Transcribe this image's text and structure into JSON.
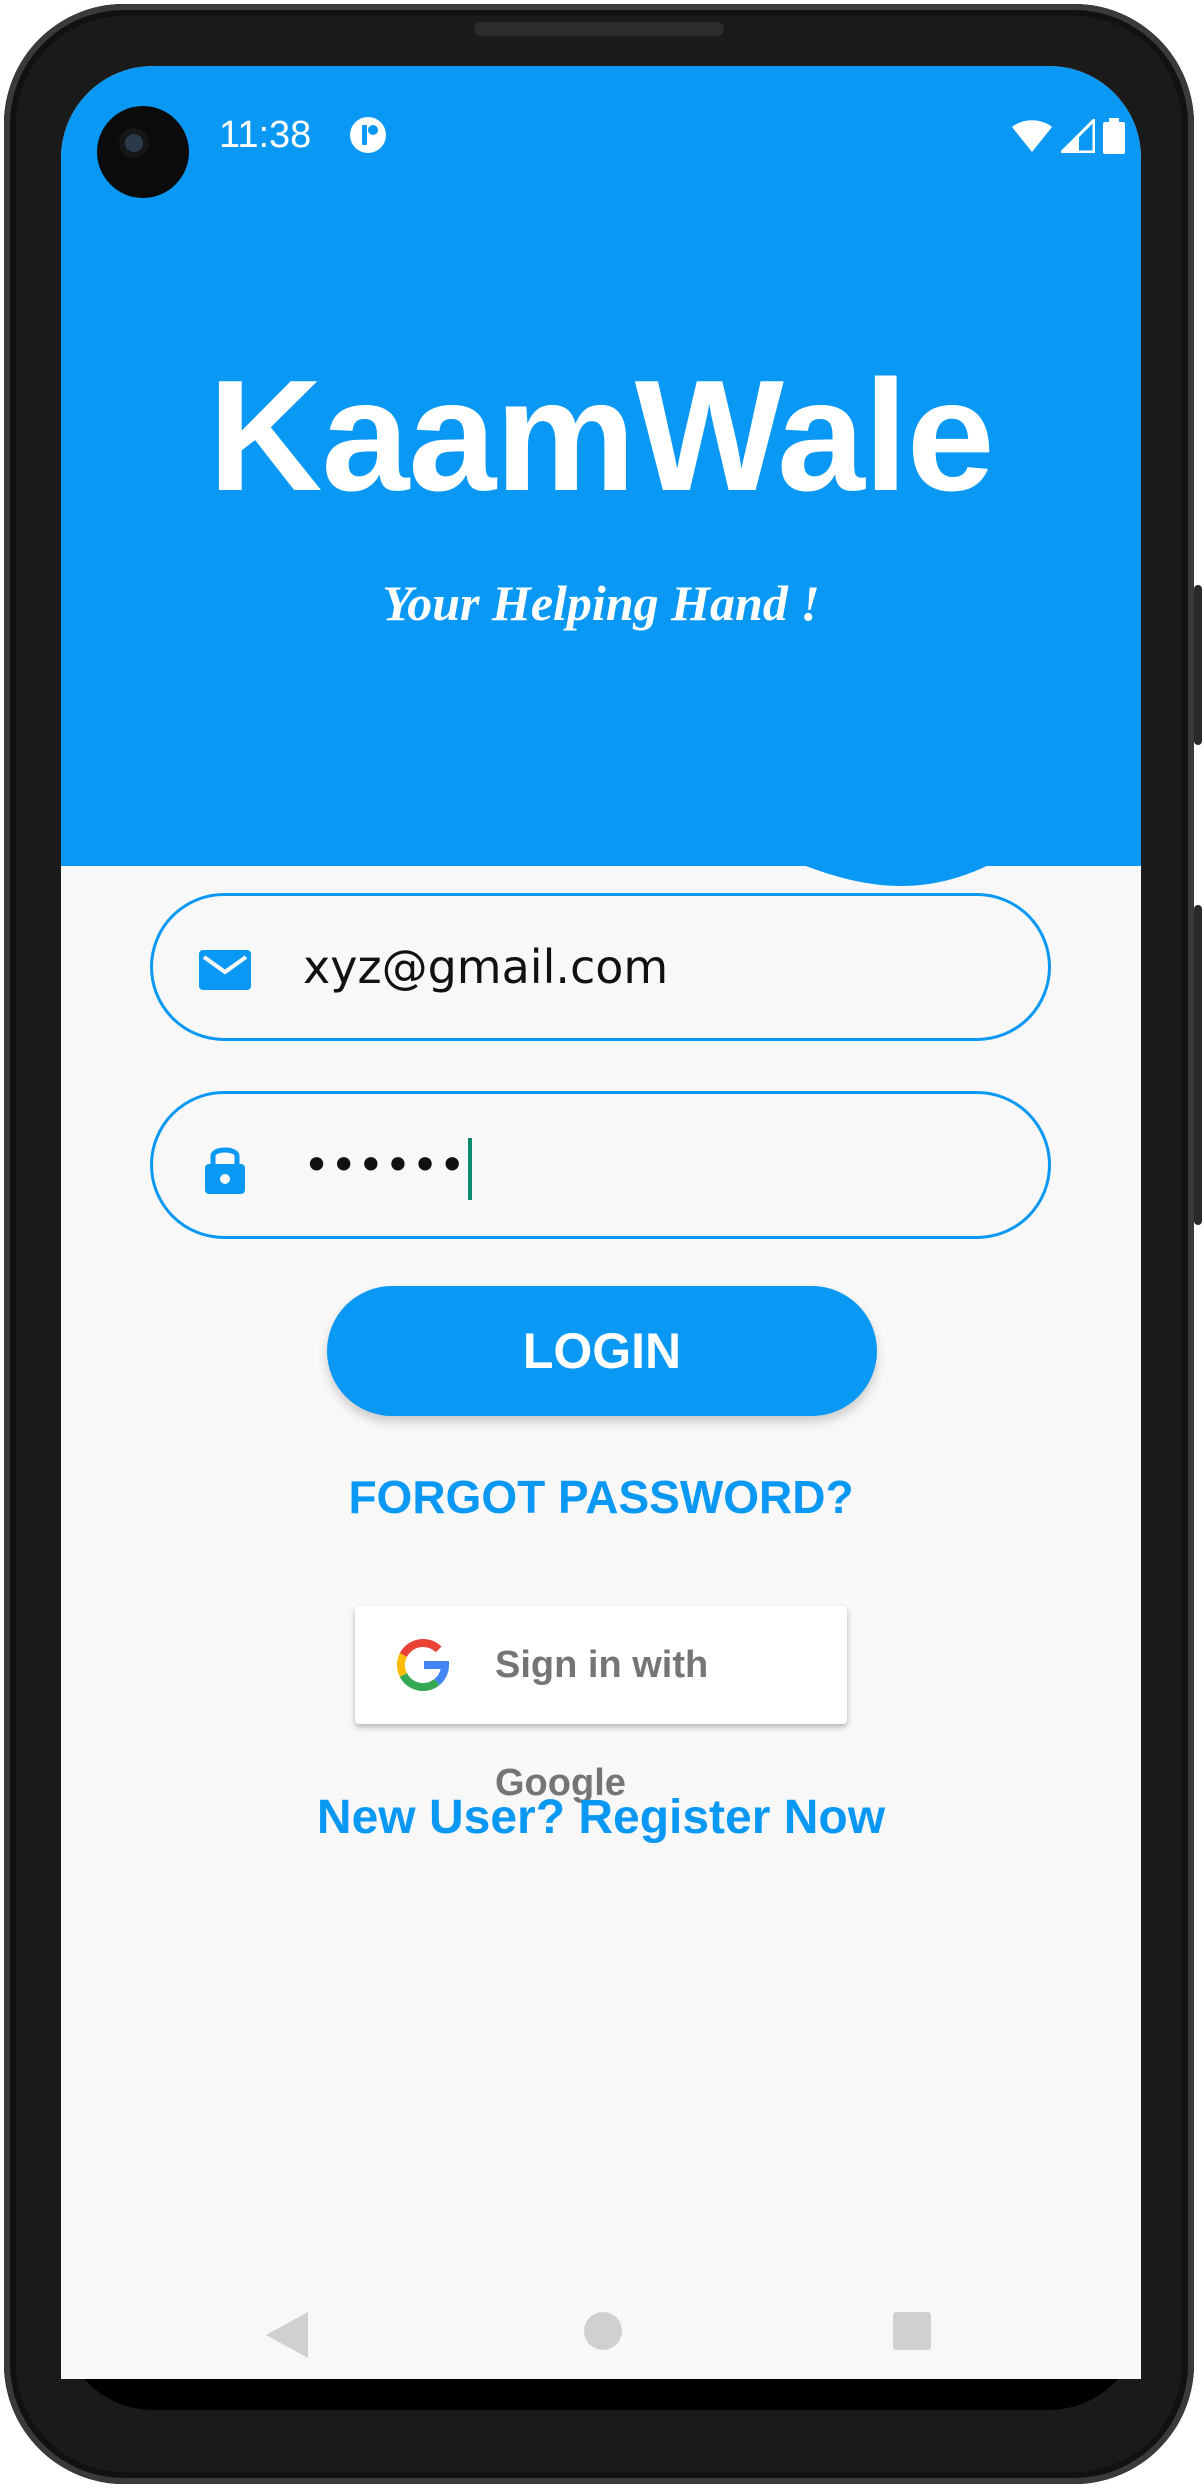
{
  "status_bar": {
    "time": "11:38"
  },
  "header": {
    "app_title": "KaamWale",
    "tagline": "Your Helping Hand !"
  },
  "login_form": {
    "email_value": "xyz@gmail.com",
    "password_masked": "••••••",
    "login_label": "LOGIN",
    "forgot_label": "FORGOT PASSWORD?",
    "google_label": "Sign in with Google",
    "register_label": "New User? Register Now"
  },
  "icons": {
    "email": "email-icon",
    "password": "lock-icon",
    "google": "google-g-icon",
    "nav": [
      "back-icon",
      "home-icon",
      "recents-icon"
    ],
    "status": [
      "wifi-icon",
      "signal-icon",
      "battery-icon",
      "app-notification-icon"
    ]
  },
  "colors": {
    "primary": "#0a98f5",
    "background": "#f8f8f8",
    "text_on_primary": "#ffffff"
  }
}
